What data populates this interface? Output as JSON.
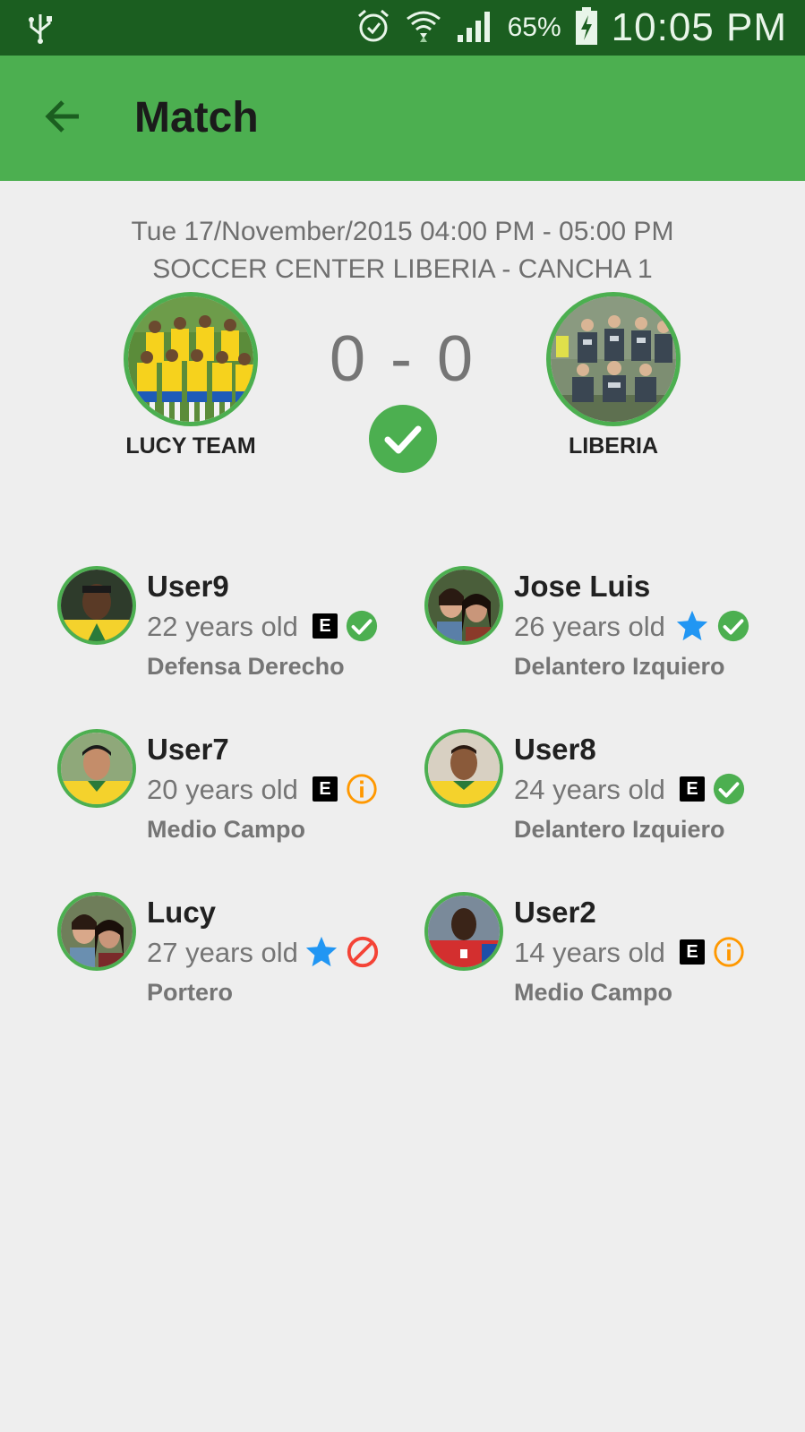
{
  "status_bar": {
    "battery_percent": "65%",
    "time": "10:05 PM",
    "icons": [
      "usb-icon",
      "alarm-icon",
      "wifi-icon",
      "signal-icon",
      "battery-charging-icon"
    ]
  },
  "app_bar": {
    "title": "Match",
    "back_icon": "arrow-back-icon"
  },
  "match": {
    "datetime": "Tue 17/November/2015 04:00 PM - 05:00 PM",
    "venue": "SOCCER CENTER LIBERIA - CANCHA 1",
    "score": "0 - 0",
    "status_icon": "check-circle-icon",
    "home_team": {
      "name": "LUCY TEAM"
    },
    "away_team": {
      "name": "LIBERIA"
    }
  },
  "colors": {
    "primary": "#4caf50",
    "primary_dark": "#1b5e20",
    "star": "#2196f3",
    "confirmed": "#4caf50",
    "pending": "#ff9800",
    "declined": "#f44336"
  },
  "players": [
    {
      "name": "User9",
      "age": "22 years old",
      "position": "Defensa Derecho",
      "badge": "E",
      "status": "confirmed"
    },
    {
      "name": "Jose Luis",
      "age": "26 years old",
      "position": "Delantero Izquiero",
      "badge": "star",
      "status": "confirmed"
    },
    {
      "name": "User7",
      "age": "20 years old",
      "position": "Medio Campo",
      "badge": "E",
      "status": "pending"
    },
    {
      "name": "User8",
      "age": "24 years old",
      "position": "Delantero Izquiero",
      "badge": "E",
      "status": "confirmed"
    },
    {
      "name": "Lucy",
      "age": "27 years old",
      "position": "Portero",
      "badge": "star",
      "status": "declined"
    },
    {
      "name": "User2",
      "age": "14 years old",
      "position": "Medio Campo",
      "badge": "E",
      "status": "pending"
    }
  ]
}
